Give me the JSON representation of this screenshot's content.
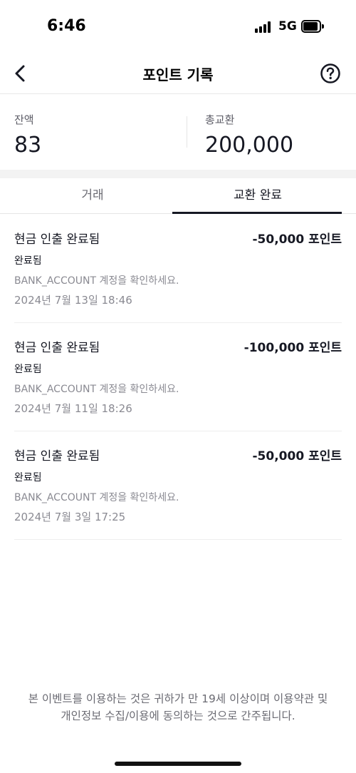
{
  "status_bar": {
    "time": "6:46",
    "network": "5G"
  },
  "nav": {
    "title": "포인트 기록",
    "back_icon": "chevron-left-icon",
    "help_icon": "question-circle-icon"
  },
  "summary": {
    "balance_label": "잔액",
    "balance_value": "83",
    "exchange_label": "총교환",
    "exchange_value": "200,000"
  },
  "tabs": [
    {
      "label": "거래",
      "active": false
    },
    {
      "label": "교환 완료",
      "active": true
    }
  ],
  "transactions": [
    {
      "title": "현금 인출 완료됨",
      "amount": "-50,000 포인트",
      "status": "완료됨",
      "description": "BANK_ACCOUNT 계정을 확인하세요.",
      "date": "2024년 7월 13일 18:46"
    },
    {
      "title": "현금 인출 완료됨",
      "amount": "-100,000 포인트",
      "status": "완료됨",
      "description": "BANK_ACCOUNT 계정을 확인하세요.",
      "date": "2024년 7월 11일 18:26"
    },
    {
      "title": "현금 인출 완료됨",
      "amount": "-50,000 포인트",
      "status": "완료됨",
      "description": "BANK_ACCOUNT 계정을 확인하세요.",
      "date": "2024년 7월 3일 17:25"
    }
  ],
  "footer": {
    "notice": "본 이벤트를 이용하는 것은 귀하가 만 19세 이상이며 이용약관 및 개인정보 수집/이용에 동의하는 것으로 간주됩니다."
  }
}
